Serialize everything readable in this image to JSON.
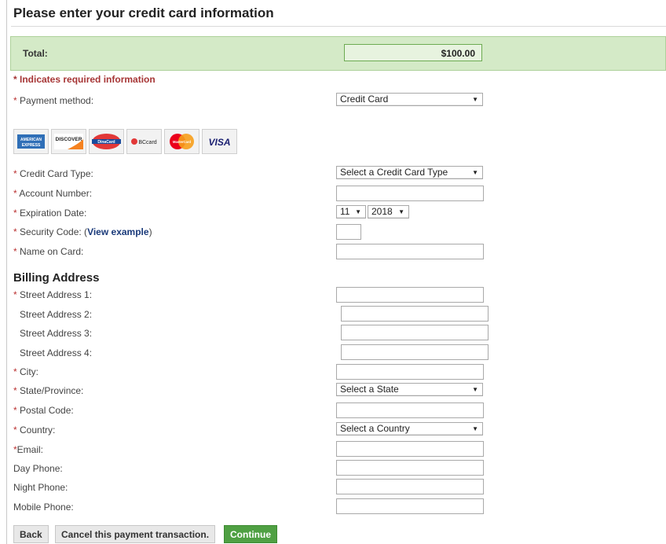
{
  "page": {
    "title": "Please enter your credit card information"
  },
  "total": {
    "label": "Total:",
    "value": "$100.00"
  },
  "required_note": "* Indicates required information",
  "payment_method": {
    "label": "Payment method:",
    "value": "Credit Card"
  },
  "card_logos": [
    {
      "name": "american-express",
      "line1": "AMERICAN",
      "line2": "EXPRESS"
    },
    {
      "name": "discover",
      "text": "DISCOVER"
    },
    {
      "name": "dinacard",
      "text": "DinaCard"
    },
    {
      "name": "bccard",
      "text": "BCcard"
    },
    {
      "name": "mastercard",
      "text": "MasterCard"
    },
    {
      "name": "visa",
      "text": "VISA"
    }
  ],
  "card": {
    "type_label": "Credit Card Type:",
    "type_value": "Select a Credit Card Type",
    "account_label": "Account Number:",
    "exp_label": "Expiration Date:",
    "exp_month": "11",
    "exp_year": "2018",
    "security_label": "Security Code: (",
    "security_link": "View example",
    "security_close": ")",
    "name_label": "Name on Card:"
  },
  "billing": {
    "title": "Billing Address",
    "street1": "Street Address 1:",
    "street2": "Street Address 2:",
    "street3": "Street Address 3:",
    "street4": "Street Address 4:",
    "city": "City:",
    "state_label": "State/Province:",
    "state_value": "Select a State",
    "postal": "Postal Code:",
    "country_label": "Country:",
    "country_value": "Select a Country",
    "email": "Email:",
    "day_phone": "Day Phone:",
    "night_phone": "Night Phone:",
    "mobile_phone": "Mobile Phone:"
  },
  "buttons": {
    "back": "Back",
    "cancel": "Cancel this payment transaction.",
    "continue": "Continue"
  },
  "colors": {
    "accent_green": "#4fa043",
    "total_bar_bg": "#d4eac7",
    "required_red": "#a63535",
    "link_blue": "#1a3a7a"
  }
}
